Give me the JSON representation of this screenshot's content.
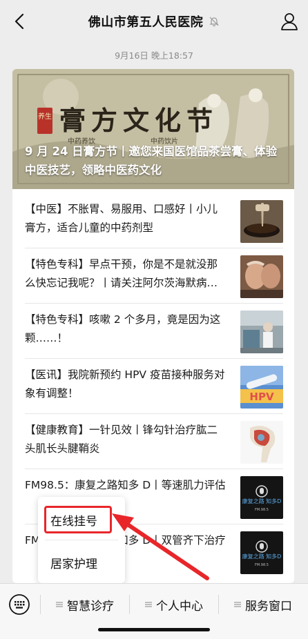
{
  "header": {
    "title": "佛山市第五人民医院"
  },
  "message": {
    "timestamp": "9月16日 晚上18:57"
  },
  "hero": {
    "title": "9 月 24 日膏方节丨邀您来国医馆品茶尝膏、体验中医技艺，领略中医药文化",
    "art_text": "膏方文化节",
    "seal_text": "养生",
    "small_text_left": "中药养饮",
    "small_text_right": "中药饮片"
  },
  "articles": [
    {
      "text": "【中医】不胀胃、易服用、口感好丨小儿膏方，适合儿童的中药剂型",
      "thumb": "medicine-bowl"
    },
    {
      "text": "【特色专科】早点干预，你是不是就没那么快忘记我呢？丨请关注阿尔茨海默病…",
      "thumb": "elderly-care"
    },
    {
      "text": "【特色专科】咳嗽 2 个多月，竟是因为这颗……！",
      "thumb": "hospital-ward"
    },
    {
      "text": "【医讯】我院新预约 HPV 疫苗接种服务对象有调整！",
      "thumb": "hpv-vaccine"
    },
    {
      "text": "【健康教育】一针见效丨锋勾针治疗肱二头肌长头腱鞘炎",
      "thumb": "shoulder-anatomy"
    },
    {
      "text": "FM98.5：康复之路知多 D丨等速肌力评估",
      "thumb": "radio-logo",
      "thumb_text": "康复之路 知多D",
      "thumb_sub": "FM.98.5"
    },
    {
      "text": "FM98.5：康复之路知多 D丨双管齐下治疗",
      "thumb": "radio-logo",
      "thumb_text": "康复之路 知多D",
      "thumb_sub": "FM.98.5"
    }
  ],
  "popup": {
    "items": [
      "在线挂号",
      "居家护理"
    ]
  },
  "bottom_menu": {
    "items": [
      "智慧诊疗",
      "个人中心",
      "服务窗口"
    ]
  },
  "colors": {
    "highlight": "#e8262a",
    "background": "#ededed"
  }
}
